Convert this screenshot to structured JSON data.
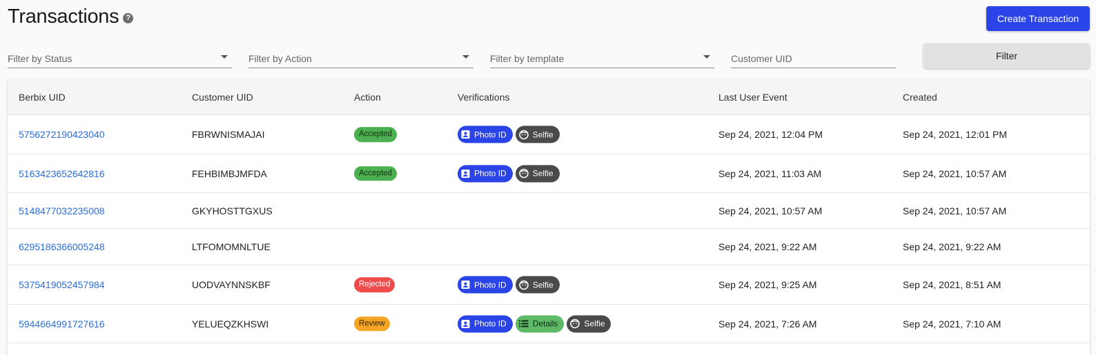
{
  "header": {
    "title": "Transactions",
    "help_icon": "?",
    "create_label": "Create Transaction"
  },
  "filters": {
    "status_placeholder": "Filter by Status",
    "action_placeholder": "Filter by Action",
    "template_placeholder": "Filter by template",
    "customer_uid_placeholder": "Customer UID",
    "filter_label": "Filter"
  },
  "table": {
    "columns": [
      "Berbix UID",
      "Customer UID",
      "Action",
      "Verifications",
      "Last User Event",
      "Created"
    ],
    "rows": [
      {
        "berbix_uid": "5756272190423040",
        "customer_uid": "FBRWNISMAJAI",
        "action": "Accepted",
        "verifications": [
          "Photo ID",
          "Selfie"
        ],
        "last_event": "Sep 24, 2021, 12:04 PM",
        "created": "Sep 24, 2021, 12:01 PM"
      },
      {
        "berbix_uid": "5163423652642816",
        "customer_uid": "FEHBIMBJMFDA",
        "action": "Accepted",
        "verifications": [
          "Photo ID",
          "Selfie"
        ],
        "last_event": "Sep 24, 2021, 11:03 AM",
        "created": "Sep 24, 2021, 10:57 AM"
      },
      {
        "berbix_uid": "5148477032235008",
        "customer_uid": "GKYHOSTTGXUS",
        "action": "",
        "verifications": [],
        "last_event": "Sep 24, 2021, 10:57 AM",
        "created": "Sep 24, 2021, 10:57 AM"
      },
      {
        "berbix_uid": "6295186366005248",
        "customer_uid": "LTFOMOMNLTUE",
        "action": "",
        "verifications": [],
        "last_event": "Sep 24, 2021, 9:22 AM",
        "created": "Sep 24, 2021, 9:22 AM"
      },
      {
        "berbix_uid": "5375419052457984",
        "customer_uid": "UODVAYNNSKBF",
        "action": "Rejected",
        "verifications": [
          "Photo ID",
          "Selfie"
        ],
        "last_event": "Sep 24, 2021, 9:25 AM",
        "created": "Sep 24, 2021, 8:51 AM"
      },
      {
        "berbix_uid": "5944664991727616",
        "customer_uid": "YELUEQZKHSWI",
        "action": "Review",
        "verifications": [
          "Photo ID",
          "Details",
          "Selfie"
        ],
        "last_event": "Sep 24, 2021, 7:26 AM",
        "created": "Sep 24, 2021, 7:10 AM"
      }
    ]
  },
  "colors": {
    "primary": "#2a44e8",
    "link": "#2a6dd9",
    "accepted": "#4caf50",
    "rejected": "#f04b4b",
    "review": "#f5a524",
    "selfie_chip": "#4a4a4a",
    "details_chip": "#5fba68"
  },
  "icons": {
    "photo_id": "id-card-icon",
    "selfie": "face-icon",
    "details": "list-icon",
    "caret": "caret-down-icon",
    "help": "help-circle-icon"
  }
}
